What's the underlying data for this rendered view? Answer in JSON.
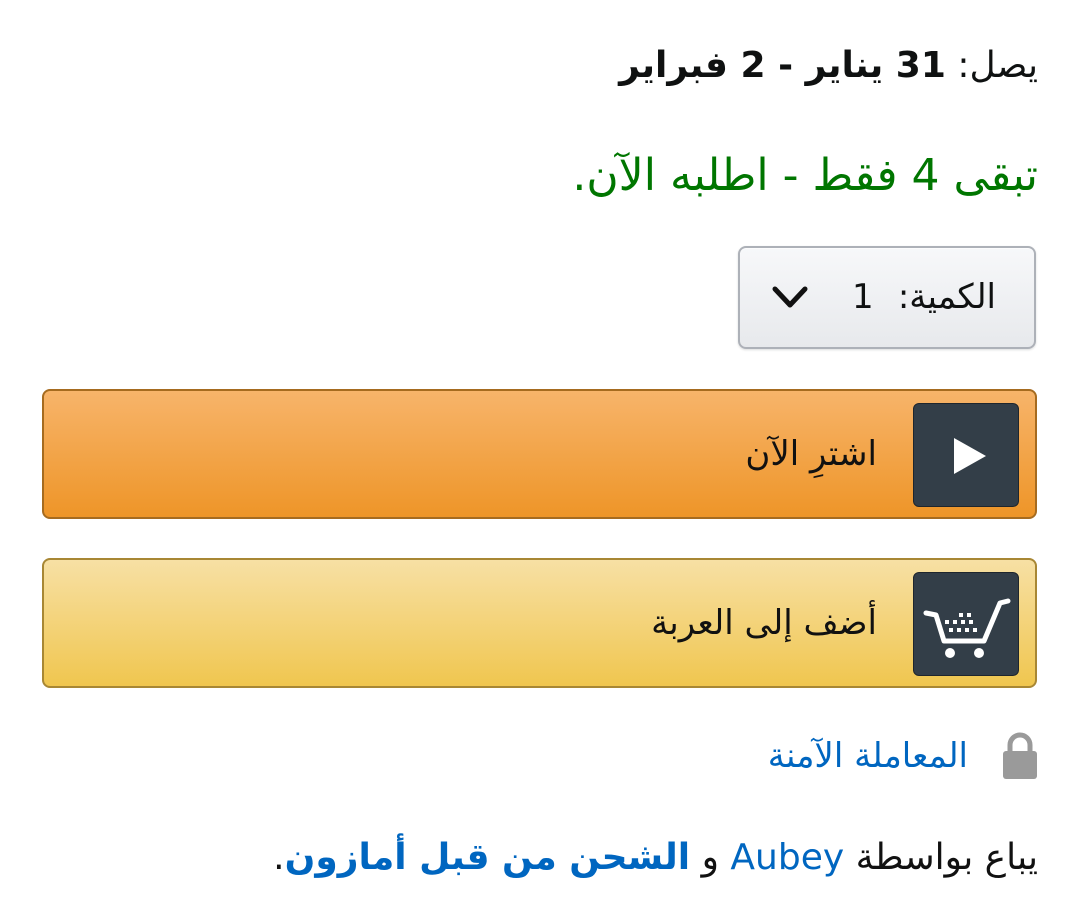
{
  "delivery": {
    "label": "يصل:",
    "dates": "31 يناير - 2 فبراير"
  },
  "stock_message": "تبقى 4 فقط - اطلبه الآن.",
  "quantity": {
    "label": "الكمية:",
    "value": "1",
    "icon": "chevron-down-icon"
  },
  "buttons": {
    "buy_now": {
      "label": "اشترِ الآن",
      "icon": "play-arrow-icon"
    },
    "add_to_cart": {
      "label": "أضف إلى العربة",
      "icon": "cart-icon"
    }
  },
  "secure_transaction": {
    "label": "المعاملة الآمنة",
    "icon": "lock-icon"
  },
  "sold_by": {
    "prefix": "يباع بواسطة",
    "seller": "Aubey",
    "conjunction": "و",
    "fulfilled": "الشحن من قبل أمازون",
    "period": "."
  },
  "colors": {
    "stock_green": "#007600",
    "link_blue": "#0066c0",
    "buy_button": "#ee9528",
    "cart_button": "#f0c64f",
    "icon_box": "#333e48"
  }
}
